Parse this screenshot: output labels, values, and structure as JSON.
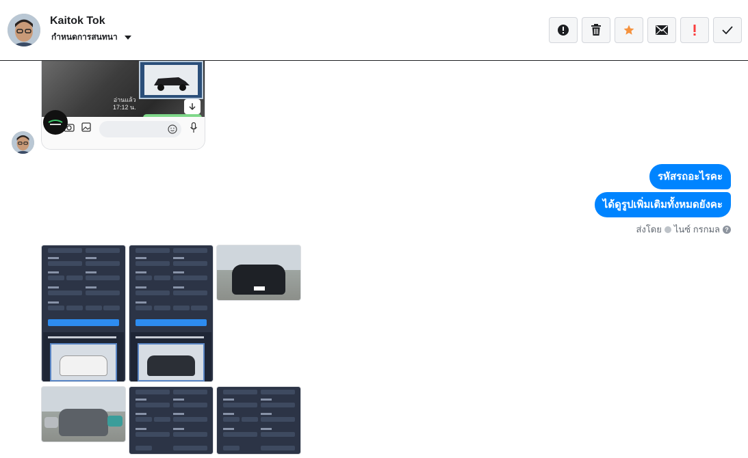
{
  "header": {
    "contact_name": "Kaitok Tok",
    "assign_label": "กำหนดการสนทนา",
    "toolbar": [
      {
        "name": "spam-button",
        "icon": "exclamation-circle-icon",
        "color": "#1c1e21"
      },
      {
        "name": "delete-button",
        "icon": "trash-icon",
        "color": "#1c1e21"
      },
      {
        "name": "star-button",
        "icon": "star-icon",
        "color": "#f5923e"
      },
      {
        "name": "mark-unread-button",
        "icon": "envelope-icon",
        "color": "#1c1e21"
      },
      {
        "name": "follow-up-button",
        "icon": "exclamation-icon",
        "color": "#fa3e3e"
      },
      {
        "name": "mark-done-button",
        "icon": "check-icon",
        "color": "#1c1e21"
      }
    ]
  },
  "image_message": {
    "read_label": "อ่านแล้ว",
    "read_time": "17:12 น."
  },
  "messages": [
    {
      "text": "รหัสรถอะไรคะ"
    },
    {
      "text": "ได้ดูรูปเพิ่มเติมทั้งหมดยังคะ"
    }
  ],
  "sent_by": {
    "prefix": "ส่งโดย",
    "name": "ไนซ์ กรกมล"
  },
  "colors": {
    "bubble": "#0084ff",
    "star": "#f5923e",
    "alert": "#fa3e3e"
  }
}
